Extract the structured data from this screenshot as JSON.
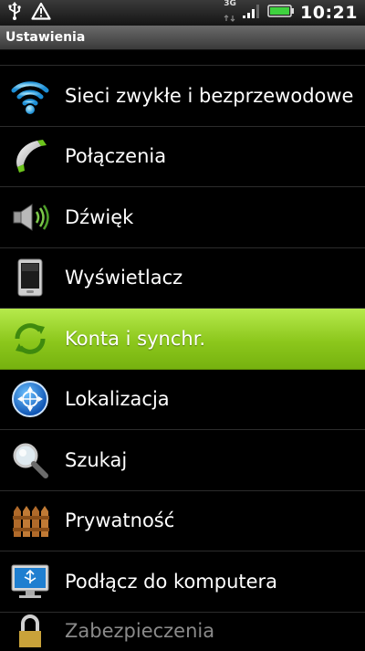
{
  "status_bar": {
    "usb_icon": "usb-icon",
    "alert_icon": "warning-icon",
    "network_type": "3G",
    "signal_icon": "signal-bars-icon",
    "battery_icon": "battery-icon",
    "time": "10:21"
  },
  "title": "Ustawienia",
  "accent_color": "#8cc71c",
  "items": [
    {
      "label": "Sieci zwykłe i bezprzewodowe",
      "icon": "wifi-icon"
    },
    {
      "label": "Połączenia",
      "icon": "phone-icon"
    },
    {
      "label": "Dźwięk",
      "icon": "speaker-icon"
    },
    {
      "label": "Wyświetlacz",
      "icon": "display-phone-icon"
    },
    {
      "label": "Konta i synchr.",
      "icon": "sync-icon",
      "selected": true
    },
    {
      "label": "Lokalizacja",
      "icon": "location-icon"
    },
    {
      "label": "Szukaj",
      "icon": "magnifier-icon"
    },
    {
      "label": "Prywatność",
      "icon": "fence-icon"
    },
    {
      "label": "Podłącz do komputera",
      "icon": "computer-usb-icon"
    },
    {
      "label": "Zabezpieczenia",
      "icon": "lock-icon"
    }
  ]
}
